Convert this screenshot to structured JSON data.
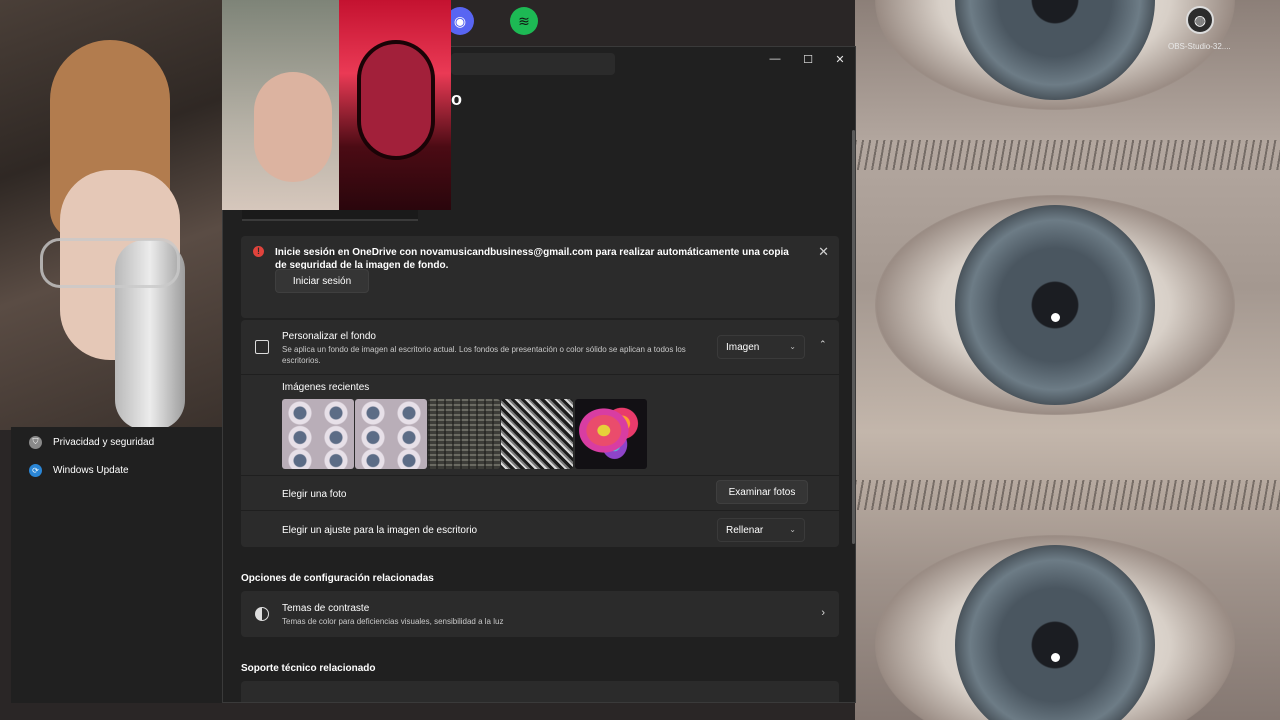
{
  "desktop": {
    "icons": [
      {
        "name": "discord",
        "label": ""
      },
      {
        "name": "spotify",
        "label": ""
      },
      {
        "name": "obs",
        "label": "OBS-Studio-32...."
      }
    ]
  },
  "window": {
    "title_fragment": "o",
    "caption": {
      "minimize": "—",
      "maximize": "☐",
      "close": "✕"
    }
  },
  "onedrive_alert": {
    "message": "Inicie sesión en OneDrive con novamusicandbusiness@gmail.com para realizar automáticamente una copia de seguridad de la imagen de fondo.",
    "button_label": "Iniciar sesión",
    "close_glyph": "✕",
    "icon_glyph": "!"
  },
  "personalize": {
    "title": "Personalizar el fondo",
    "description": "Se aplica un fondo de imagen al escritorio actual. Los fondos de presentación o color sólido se aplican a todos los escritorios.",
    "selected": "Imagen",
    "recent_images_label": "Imágenes recientes",
    "choose_photo_label": "Elegir una foto",
    "browse_button": "Examinar fotos",
    "fit_label": "Elegir un ajuste para la imagen de escritorio",
    "fit_selected": "Rellenar"
  },
  "related_settings": {
    "title": "Opciones de configuración relacionadas",
    "contrast_title": "Temas de contraste",
    "contrast_subtitle": "Temas de color para deficiencias visuales, sensibilidad a la luz"
  },
  "related_support": {
    "title": "Soporte técnico relacionado"
  },
  "sidebar": {
    "items": [
      {
        "label": "Privacidad y seguridad",
        "icon": "shield-icon"
      },
      {
        "label": "Windows Update",
        "icon": "update-icon"
      }
    ]
  },
  "colors": {
    "window_bg": "#202020",
    "card_bg": "#2b2b2b",
    "alert_icon": "#e0433c",
    "discord": "#5865f2",
    "spotify": "#1db954",
    "update_blue": "#2a86d6"
  }
}
